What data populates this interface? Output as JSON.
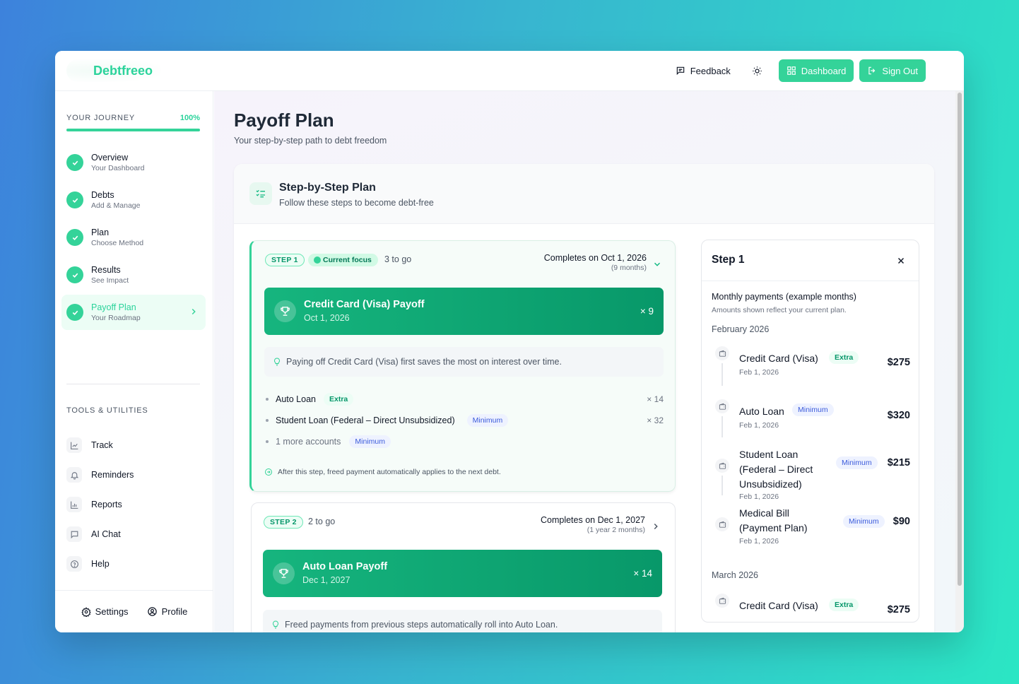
{
  "brand": {
    "name": "Debtfreeo"
  },
  "topbar": {
    "feedback_label": "Feedback",
    "dashboard_label": "Dashboard",
    "signout_label": "Sign Out"
  },
  "sidebar": {
    "journey_label": "YOUR JOURNEY",
    "journey_pct": "100%",
    "journey_progress": 1.0,
    "steps": [
      {
        "title": "Overview",
        "sub": "Your Dashboard"
      },
      {
        "title": "Debts",
        "sub": "Add & Manage"
      },
      {
        "title": "Plan",
        "sub": "Choose Method"
      },
      {
        "title": "Results",
        "sub": "See Impact"
      },
      {
        "title": "Payoff Plan",
        "sub": "Your Roadmap"
      }
    ],
    "tools_label": "TOOLS & UTILITIES",
    "tools": [
      {
        "label": "Track",
        "icon": "chart-line-icon"
      },
      {
        "label": "Reminders",
        "icon": "bell-icon"
      },
      {
        "label": "Reports",
        "icon": "bar-chart-icon"
      },
      {
        "label": "AI Chat",
        "icon": "chat-icon"
      },
      {
        "label": "Help",
        "icon": "help-circle-icon"
      }
    ],
    "settings_label": "Settings",
    "profile_label": "Profile"
  },
  "page": {
    "title": "Payoff Plan",
    "subtitle": "Your step-by-step path to debt freedom"
  },
  "plan_card": {
    "title": "Step-by-Step Plan",
    "subtitle": "Follow these steps to become debt-free"
  },
  "step1": {
    "pill": "STEP 1",
    "focus": "Current focus",
    "togo": "3 to go",
    "completes": "Completes on Oct 1, 2026",
    "duration": "(9 months)",
    "payoff_title": "Credit Card (Visa) Payoff",
    "payoff_date": "Oct 1, 2026",
    "payoff_mult": "× 9",
    "tip": "Paying off Credit Card (Visa) first saves the most on interest over time.",
    "accounts": [
      {
        "name": "Auto Loan",
        "badge": "Extra",
        "mult": "× 14"
      },
      {
        "name": "Student Loan (Federal – Direct Unsubsidized)",
        "badge": "Minimum",
        "mult": "× 32"
      },
      {
        "name": "1 more accounts",
        "badge": "Minimum",
        "mult": ""
      }
    ],
    "after_note": "After this step, freed payment automatically applies to the next debt."
  },
  "step2": {
    "pill": "STEP 2",
    "togo": "2 to go",
    "completes": "Completes on Dec 1, 2027",
    "duration": "(1 year 2 months)",
    "payoff_title": "Auto Loan Payoff",
    "payoff_date": "Dec 1, 2027",
    "payoff_mult": "× 14",
    "tip": "Freed payments from previous steps automatically roll into Auto Loan."
  },
  "detail": {
    "title": "Step 1",
    "monthly_title": "Monthly payments (example months)",
    "monthly_note": "Amounts shown reflect your current plan.",
    "months": [
      {
        "label": "February 2026",
        "payments": [
          {
            "name": "Credit Card (Visa)",
            "badge": "Extra",
            "date": "Feb 1, 2026",
            "amount": "$275"
          },
          {
            "name": "Auto Loan",
            "badge": "Minimum",
            "date": "Feb 1, 2026",
            "amount": "$320"
          },
          {
            "name": "Student Loan (Federal – Direct Unsubsidized)",
            "badge": "Minimum",
            "date": "Feb 1, 2026",
            "amount": "$215"
          },
          {
            "name": "Medical Bill (Payment Plan)",
            "badge": "Minimum",
            "date": "Feb 1, 2026",
            "amount": "$90"
          }
        ]
      },
      {
        "label": "March 2026",
        "payments": [
          {
            "name": "Credit Card (Visa)",
            "badge": "Extra",
            "date": "",
            "amount": "$275"
          }
        ]
      }
    ]
  },
  "colors": {
    "accent": "#34d399",
    "brand_text": "#2bd39b",
    "banner": "#0b9f6e",
    "min_badge": "#3b5bdb"
  }
}
